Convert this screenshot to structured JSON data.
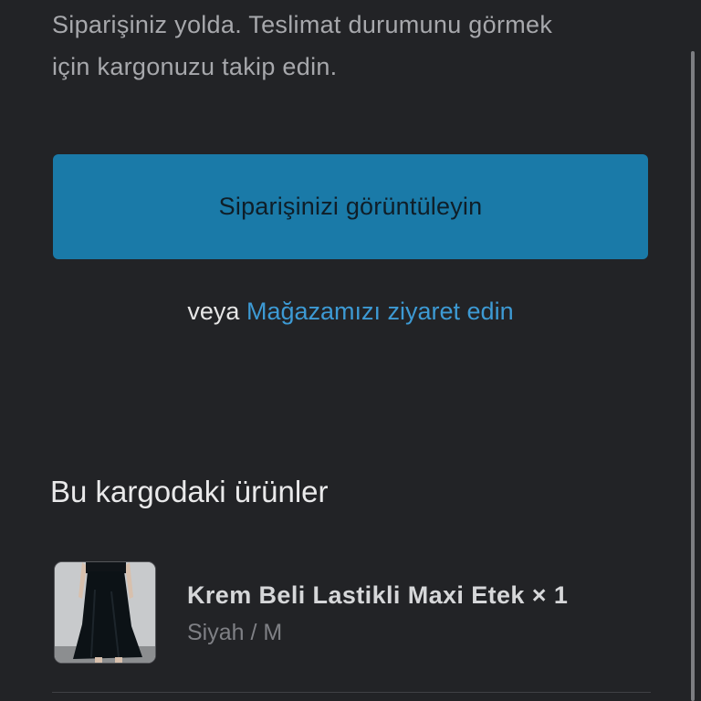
{
  "intro": {
    "line1": "Siparişiniz yolda. Teslimat durumunu görmek",
    "line2": "için kargonuzu takip edin."
  },
  "cta": {
    "label": "Siparişinizi görüntüleyin"
  },
  "alternate": {
    "prefix": "veya",
    "link": "Mağazamızı ziyaret edin"
  },
  "section": {
    "title": "Bu kargodaki ürünler"
  },
  "product": {
    "name": "Krem Beli Lastikli Maxi Etek × 1",
    "variant": "Siyah / M",
    "image": "black-maxi-skirt-photo"
  },
  "colors": {
    "background": "#222326",
    "button": "#1a7aa8",
    "link": "#3d9ad4"
  }
}
